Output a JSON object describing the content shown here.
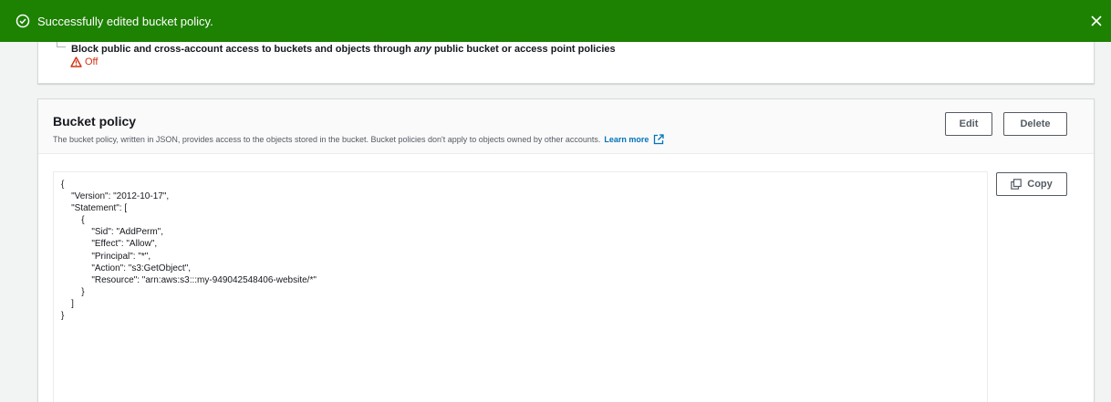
{
  "flash": {
    "message": "Successfully edited bucket policy.",
    "background": "#1d8102",
    "icon": "check-circle-icon",
    "close_icon": "close-icon"
  },
  "block_public_access": {
    "setting_label_pre": "Block public and cross-account access to buckets and objects through ",
    "setting_label_em": "any",
    "setting_label_post": " public bucket or access point policies",
    "status": "Off",
    "status_icon": "warning-icon",
    "status_color": "#d13212"
  },
  "bucket_policy": {
    "title": "Bucket policy",
    "description": "The bucket policy, written in JSON, provides access to the objects stored in the bucket. Bucket policies don't apply to objects owned by other accounts.",
    "learn_more": "Learn more",
    "edit_label": "Edit",
    "delete_label": "Delete",
    "copy_label": "Copy",
    "policy_lines": [
      "{",
      "    \"Version\": \"2012-10-17\",",
      "    \"Statement\": [",
      "        {",
      "            \"Sid\": \"AddPerm\",",
      "            \"Effect\": \"Allow\",",
      "            \"Principal\": \"*\",",
      "            \"Action\": \"s3:GetObject\",",
      "            \"Resource\": \"arn:aws:s3:::my-949042548406-website/*\"",
      "        }",
      "    ]",
      "}"
    ]
  }
}
